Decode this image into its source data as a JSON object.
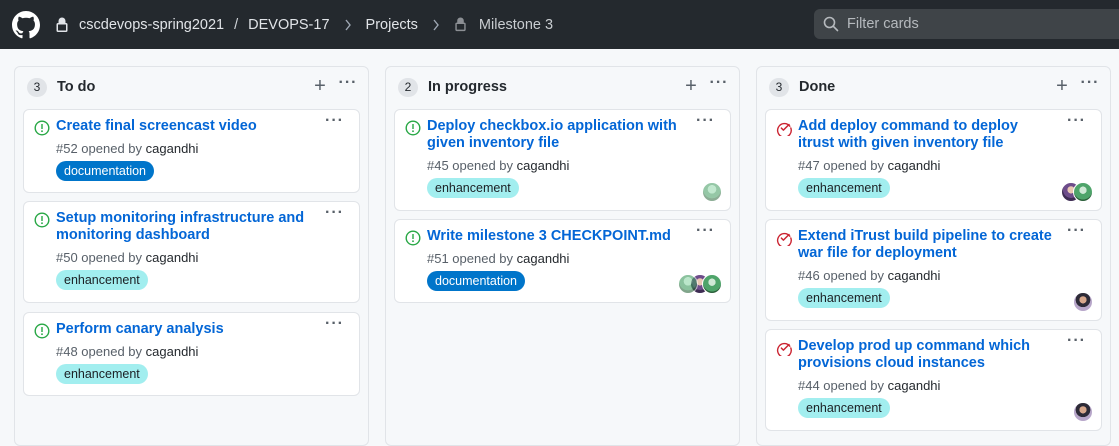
{
  "breadcrumb": {
    "org": "cscdevops-spring2021",
    "sep": "/",
    "repo": "DEVOPS-17",
    "projects": "Projects",
    "milestone": "Milestone 3"
  },
  "filter": {
    "placeholder": "Filter cards"
  },
  "columns": [
    {
      "count": "3",
      "title": "To do",
      "cards": [
        {
          "title": "Create final screencast video",
          "number": "#52 opened by",
          "user": "cagandhi",
          "label": "documentation"
        },
        {
          "title": "Setup monitoring infrastructure and monitoring dashboard",
          "number": "#50 opened by",
          "user": "cagandhi",
          "label": "enhancement"
        },
        {
          "title": "Perform canary analysis",
          "number": "#48 opened by",
          "user": "cagandhi",
          "label": "enhancement"
        }
      ]
    },
    {
      "count": "2",
      "title": "In progress",
      "cards": [
        {
          "title": "Deploy checkbox.io application with given inventory file",
          "number": "#45 opened by",
          "user": "cagandhi",
          "label": "enhancement"
        },
        {
          "title": "Write milestone 3 CHECKPOINT.md",
          "number": "#51 opened by",
          "user": "cagandhi",
          "label": "documentation"
        }
      ]
    },
    {
      "count": "3",
      "title": "Done",
      "cards": [
        {
          "title": "Add deploy command to deploy itrust with given inventory file",
          "number": "#47 opened by",
          "user": "cagandhi",
          "label": "enhancement"
        },
        {
          "title": "Extend iTrust build pipeline to create war file for deployment",
          "number": "#46 opened by",
          "user": "cagandhi",
          "label": "enhancement"
        },
        {
          "title": "Develop prod up command which provisions cloud instances",
          "number": "#44 opened by",
          "user": "cagandhi",
          "label": "enhancement"
        }
      ]
    }
  ],
  "colors": {
    "open_issue": "#28a745",
    "closed_issue": "#cb2431",
    "link": "#0366d6",
    "topbar": "#24292e"
  },
  "icons": {
    "logo": "github-mark-icon",
    "lock": "lock-icon",
    "search": "search-icon",
    "open": "issue-opened-icon",
    "closed": "issue-closed-icon"
  }
}
